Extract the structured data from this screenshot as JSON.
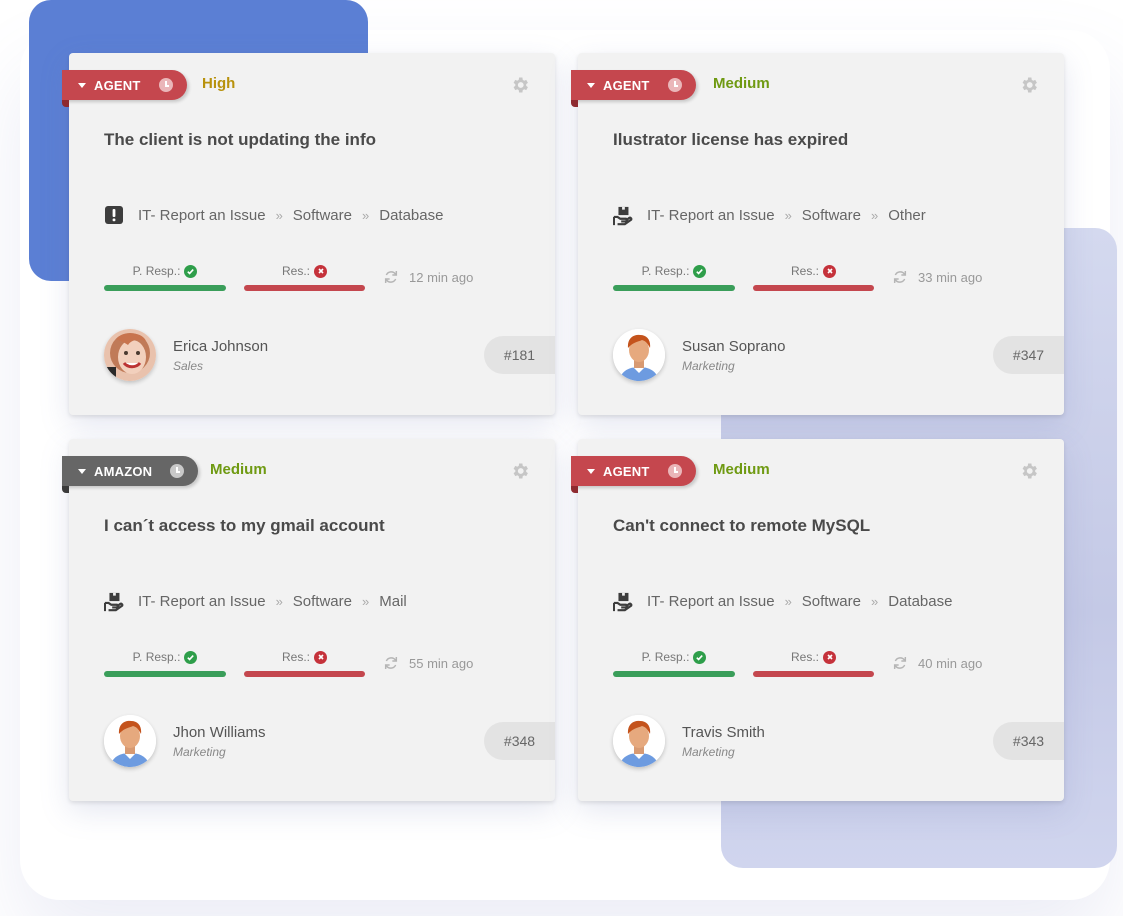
{
  "colors": {
    "tag_agent": "#c5474e",
    "tag_amazon": "#666666",
    "priority_high": "#b8920d",
    "priority_medium": "#6f9a12",
    "status_ok": "#3a9e5a",
    "status_bad": "#c4474e",
    "bg_blue": "#5b7fd4",
    "bg_lavender": "#c4c9e6"
  },
  "labels": {
    "first_response": "P. Resp.:",
    "resolution": "Res.:",
    "crumb_separator": "»"
  },
  "tickets": [
    {
      "tag": "AGENT",
      "tag_style": "red",
      "priority": "High",
      "title": "The client is not updating the info",
      "category_icon": "exclamation-icon",
      "breadcrumb": [
        "IT- Report an Issue",
        "Software",
        "Database"
      ],
      "first_response_met": true,
      "resolution_met": false,
      "updated": "12 min ago",
      "user": {
        "name": "Erica Johnson",
        "department": "Sales",
        "avatar": "photo-avatar"
      },
      "number": "#181"
    },
    {
      "tag": "AGENT",
      "tag_style": "red",
      "priority": "Medium",
      "title": "Ilustrator license has expired",
      "category_icon": "hand-box-icon",
      "breadcrumb": [
        "IT- Report an Issue",
        "Software",
        "Other"
      ],
      "first_response_met": true,
      "resolution_met": false,
      "updated": "33 min ago",
      "user": {
        "name": "Susan Soprano",
        "department": "Marketing",
        "avatar": "default-avatar"
      },
      "number": "#347"
    },
    {
      "tag": "AMAZON",
      "tag_style": "gray",
      "priority": "Medium",
      "title": "I can´t access to my gmail account",
      "category_icon": "hand-box-icon",
      "breadcrumb": [
        "IT- Report an Issue",
        "Software",
        "Mail"
      ],
      "first_response_met": true,
      "resolution_met": false,
      "updated": "55 min ago",
      "user": {
        "name": "Jhon Williams",
        "department": "Marketing",
        "avatar": "default-avatar"
      },
      "number": "#348"
    },
    {
      "tag": "AGENT",
      "tag_style": "red",
      "priority": "Medium",
      "title": "Can't connect to remote MySQL",
      "category_icon": "hand-box-icon",
      "breadcrumb": [
        "IT- Report an Issue",
        "Software",
        "Database"
      ],
      "first_response_met": true,
      "resolution_met": false,
      "updated": "40 min ago",
      "user": {
        "name": "Travis Smith",
        "department": "Marketing",
        "avatar": "default-avatar"
      },
      "number": "#343"
    }
  ]
}
